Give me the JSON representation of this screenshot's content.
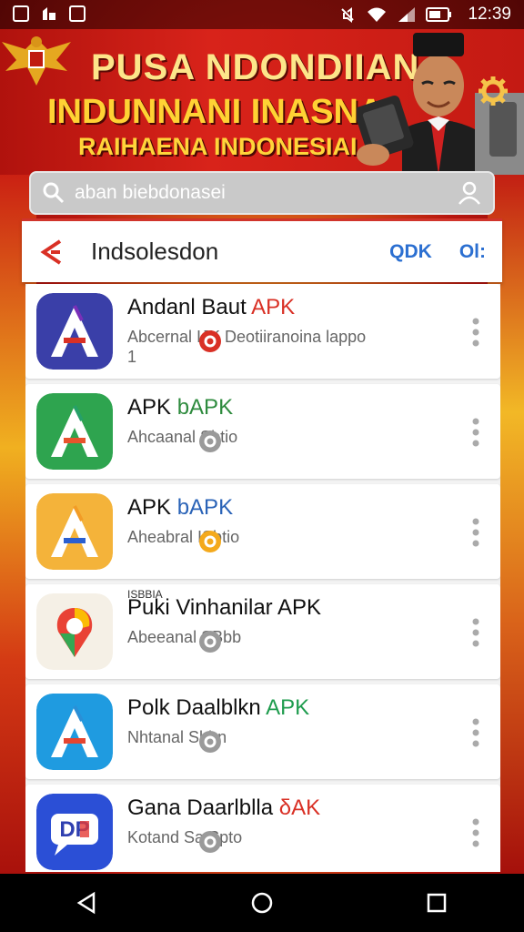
{
  "status_bar": {
    "time": "12:39",
    "left_icons": [
      "image-icon",
      "notification-icon",
      "screenshot-icon"
    ],
    "right_icons": [
      "mute-icon",
      "wifi-icon",
      "signal-icon",
      "battery-icon"
    ]
  },
  "banner": {
    "line1": "PUSA NDONDIIAN",
    "line2": "INDUNNANI INASNA",
    "line3": "RAIHAENA INDONESIAI"
  },
  "search": {
    "text": "aban biebdonasei"
  },
  "header": {
    "title": "Indsolesdon",
    "action1": "QDK",
    "action2": "Ol:"
  },
  "apps": [
    {
      "name": "Andanl Baut",
      "tag": "APK",
      "tag_color": "#d93025",
      "sub": "Abcernal  IJK Deotiiranoina lappo",
      "sub2": "1",
      "icon_colors": [
        "#3a3fa8",
        "#7a2fb8",
        "#d93025"
      ],
      "icon_name": "app-a-icon"
    },
    {
      "name": "APK",
      "tag": "bAPK",
      "tag_color": "#2e8b3e",
      "sub": "Ahcaanal      Sbtio",
      "icon_colors": [
        "#2ea44f",
        "#26a069",
        "#e8532c"
      ],
      "icon_name": "app-a-green-icon"
    },
    {
      "name": "APK",
      "tag": "bAPK",
      "tag_color": "#2a63b7",
      "sub": "Aheabral      ISbtio",
      "icon_colors": [
        "#f4b33a",
        "#f29c26",
        "#2a5fd0"
      ],
      "icon_name": "app-a-orange-icon"
    },
    {
      "name": "Puki Vinhanilar APK",
      "tag": "",
      "tag_color": "#111111",
      "topline": "ISBBIA",
      "sub": "Abeeanal      SBbb",
      "icon_colors": [
        "#f5f0e6",
        "#e94235",
        "#34a853"
      ],
      "icon_name": "app-pin-icon"
    },
    {
      "name": "Polk Daalblkn",
      "tag": "APK",
      "tag_color": "#1f9c4e",
      "sub": "Nhtanal      Sbhn",
      "icon_colors": [
        "#1f9be0",
        "#2a8fd6",
        "#e54530"
      ],
      "icon_name": "app-a-blue-icon"
    },
    {
      "name": "Gana Daarlblla",
      "tag": "δAK",
      "tag_color": "#d93025",
      "sub": "Kotand  Sa  Spto",
      "icon_colors": [
        "#2b4fd6",
        "#2f3fb0",
        "#e53935"
      ],
      "icon_name": "app-dp-icon"
    }
  ],
  "nav": {
    "buttons": [
      "back-nav-icon",
      "home-nav-icon",
      "recents-nav-icon"
    ]
  }
}
